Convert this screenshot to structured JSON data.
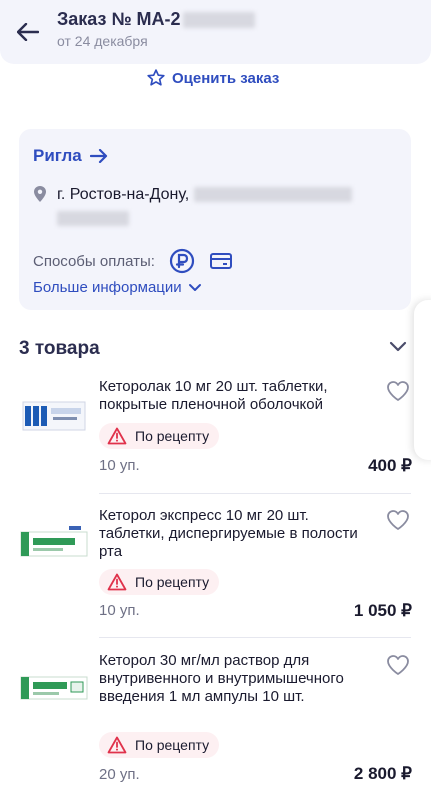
{
  "header": {
    "title": "Заказ № МА-2",
    "date": "от 24 декабря"
  },
  "rate_label": "Оценить заказ",
  "pharmacy": {
    "name": "Ригла",
    "address": "г. Ростов-на-Дону,",
    "payment_label": "Способы оплаты:",
    "more_label": "Больше информации",
    "payment_icons": [
      "sbp-icon",
      "card-icon"
    ]
  },
  "items_title": "3 товара",
  "items": [
    {
      "name": "Кеторолак 10 мг 20 шт. таблетки, покрытые пленочной оболочкой",
      "rx": "По рецепту",
      "qty": "10 уп.",
      "price": "400 ₽"
    },
    {
      "name": "Кеторол экспресс 10 мг 20 шт. таблетки, диспергируемые в полости рта",
      "rx": "По рецепту",
      "qty": "10 уп.",
      "price": "1 050 ₽"
    },
    {
      "name": "Кеторол 30 мг/мл раствор для внутривенного и внутримышечного введения 1 мл ампулы 10 шт.",
      "rx": "По рецепту",
      "qty": "20 уп.",
      "price": "2 800 ₽"
    }
  ],
  "colors": {
    "accent": "#2f4dbf",
    "card_bg": "#f3f4fb",
    "rx_bg": "#fdf0f2",
    "rx_icon": "#e0324b"
  }
}
